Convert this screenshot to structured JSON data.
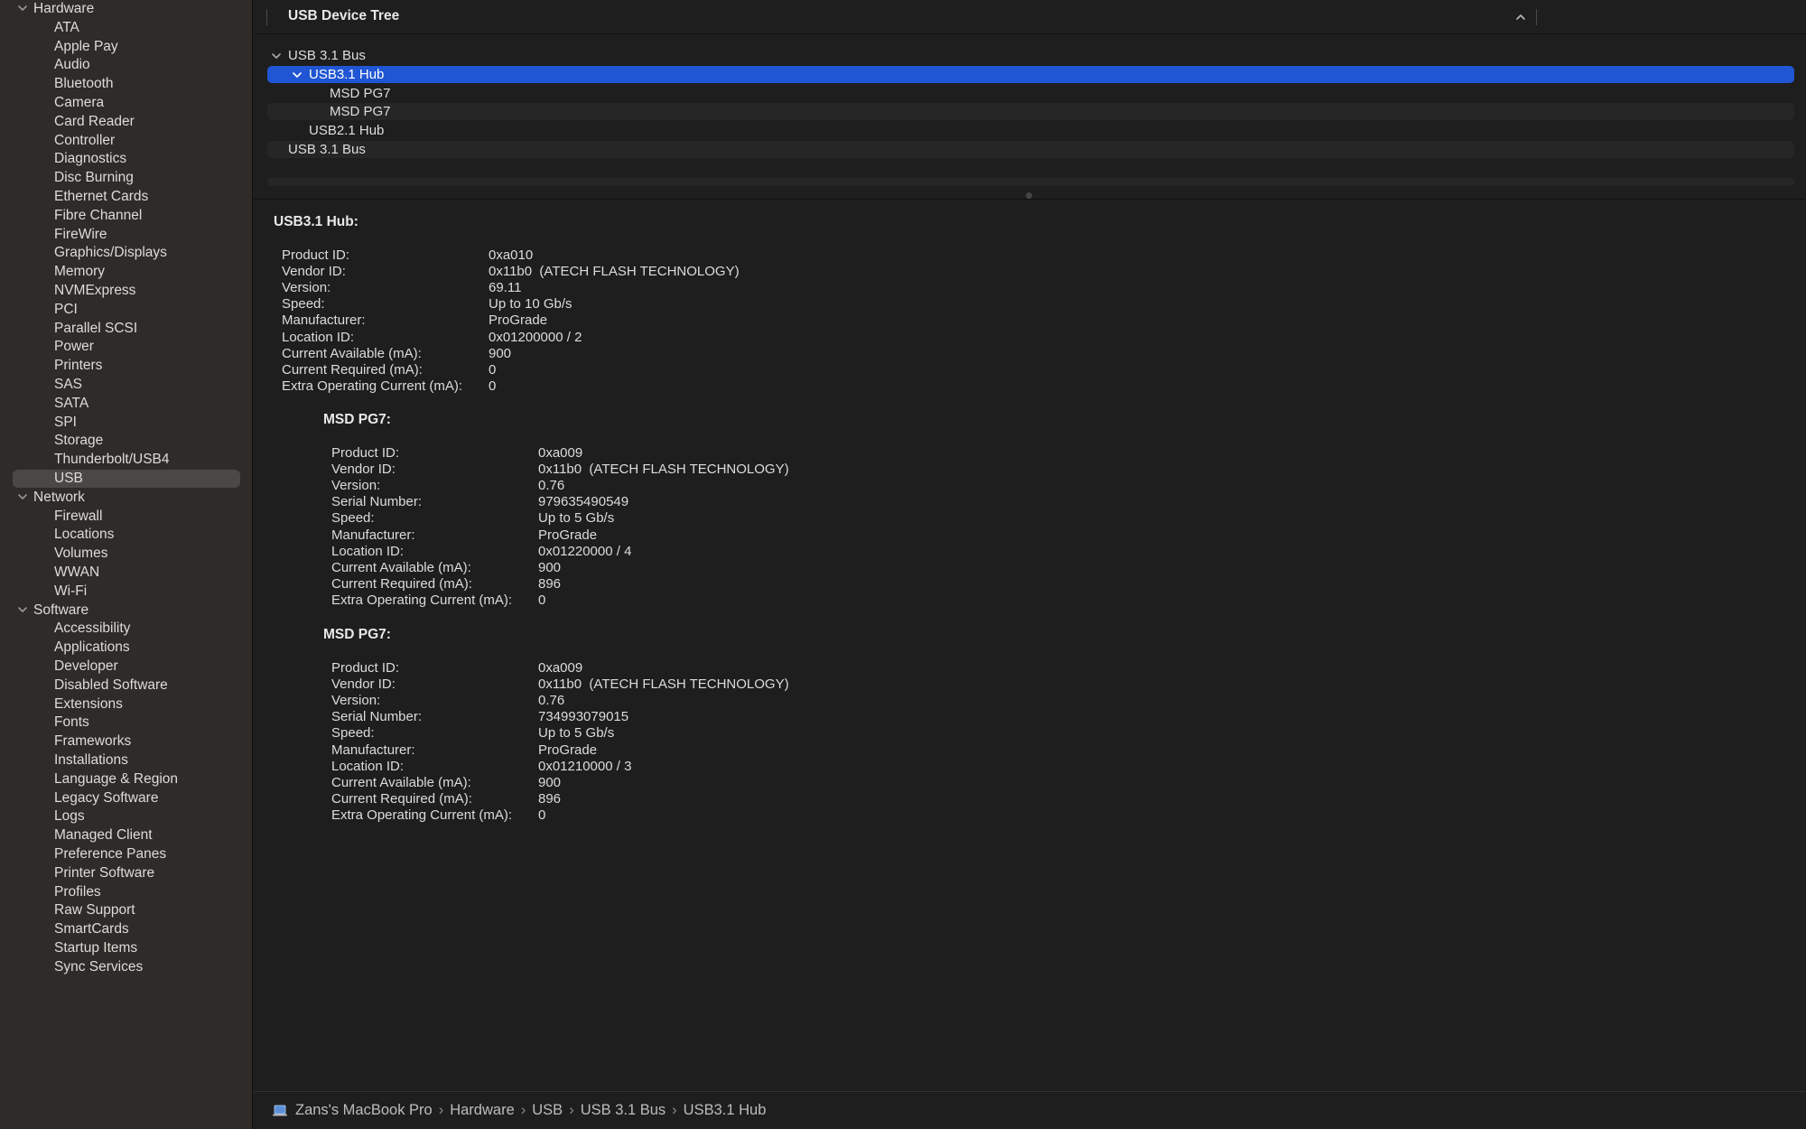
{
  "sidebar": {
    "sections": [
      {
        "label": "Hardware",
        "items": [
          "ATA",
          "Apple Pay",
          "Audio",
          "Bluetooth",
          "Camera",
          "Card Reader",
          "Controller",
          "Diagnostics",
          "Disc Burning",
          "Ethernet Cards",
          "Fibre Channel",
          "FireWire",
          "Graphics/Displays",
          "Memory",
          "NVMExpress",
          "PCI",
          "Parallel SCSI",
          "Power",
          "Printers",
          "SAS",
          "SATA",
          "SPI",
          "Storage",
          "Thunderbolt/USB4",
          "USB"
        ]
      },
      {
        "label": "Network",
        "items": [
          "Firewall",
          "Locations",
          "Volumes",
          "WWAN",
          "Wi-Fi"
        ]
      },
      {
        "label": "Software",
        "items": [
          "Accessibility",
          "Applications",
          "Developer",
          "Disabled Software",
          "Extensions",
          "Fonts",
          "Frameworks",
          "Installations",
          "Language & Region",
          "Legacy Software",
          "Logs",
          "Managed Client",
          "Preference Panes",
          "Printer Software",
          "Profiles",
          "Raw Support",
          "SmartCards",
          "Startup Items",
          "Sync Services"
        ]
      }
    ],
    "selected": "USB"
  },
  "tree": {
    "title": "USB Device Tree",
    "rows": [
      {
        "label": "USB 3.1 Bus",
        "level": 0,
        "expanded": true
      },
      {
        "label": "USB3.1 Hub",
        "level": 1,
        "expanded": true,
        "selected": true
      },
      {
        "label": "MSD PG7",
        "level": 2
      },
      {
        "label": "MSD PG7",
        "level": 2
      },
      {
        "label": "USB2.1 Hub",
        "level": 1
      },
      {
        "label": "USB 3.1 Bus",
        "level": 0
      }
    ]
  },
  "details": {
    "hub": {
      "title": "USB3.1 Hub:",
      "fields": [
        [
          "Product ID:",
          "0xa010"
        ],
        [
          "Vendor ID:",
          "0x11b0  (ATECH FLASH TECHNOLOGY)"
        ],
        [
          "Version:",
          "69.11"
        ],
        [
          "Speed:",
          "Up to 10 Gb/s"
        ],
        [
          "Manufacturer:",
          "ProGrade"
        ],
        [
          "Location ID:",
          "0x01200000 / 2"
        ],
        [
          "Current Available (mA):",
          "900"
        ],
        [
          "Current Required (mA):",
          "0"
        ],
        [
          "Extra Operating Current (mA):",
          "0"
        ]
      ]
    },
    "devices": [
      {
        "title": "MSD PG7:",
        "fields": [
          [
            "Product ID:",
            "0xa009"
          ],
          [
            "Vendor ID:",
            "0x11b0  (ATECH FLASH TECHNOLOGY)"
          ],
          [
            "Version:",
            "0.76"
          ],
          [
            "Serial Number:",
            "979635490549"
          ],
          [
            "Speed:",
            "Up to 5 Gb/s"
          ],
          [
            "Manufacturer:",
            "ProGrade"
          ],
          [
            "Location ID:",
            "0x01220000 / 4"
          ],
          [
            "Current Available (mA):",
            "900"
          ],
          [
            "Current Required (mA):",
            "896"
          ],
          [
            "Extra Operating Current (mA):",
            "0"
          ]
        ]
      },
      {
        "title": "MSD PG7:",
        "fields": [
          [
            "Product ID:",
            "0xa009"
          ],
          [
            "Vendor ID:",
            "0x11b0  (ATECH FLASH TECHNOLOGY)"
          ],
          [
            "Version:",
            "0.76"
          ],
          [
            "Serial Number:",
            "734993079015"
          ],
          [
            "Speed:",
            "Up to 5 Gb/s"
          ],
          [
            "Manufacturer:",
            "ProGrade"
          ],
          [
            "Location ID:",
            "0x01210000 / 3"
          ],
          [
            "Current Available (mA):",
            "900"
          ],
          [
            "Current Required (mA):",
            "896"
          ],
          [
            "Extra Operating Current (mA):",
            "0"
          ]
        ]
      }
    ]
  },
  "breadcrumb": [
    "Zans's MacBook Pro",
    "Hardware",
    "USB",
    "USB 3.1 Bus",
    "USB3.1 Hub"
  ],
  "colors": {
    "selection": "#2056d4",
    "sidebar_bg": "#2e2b28",
    "content_bg": "#1e1e1e"
  }
}
